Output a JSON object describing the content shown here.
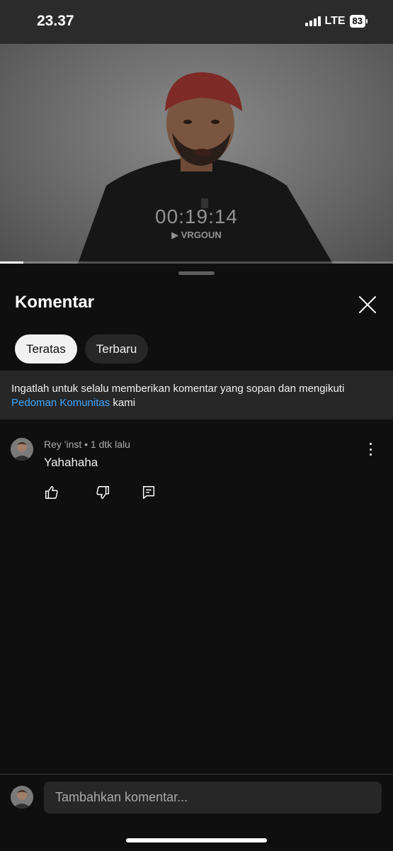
{
  "status_bar": {
    "time": "23.37",
    "network": "LTE",
    "battery": "83"
  },
  "video": {
    "timestamp": "00:19:14",
    "watermark": "VRGOUN",
    "progress": 0.06
  },
  "sheet": {
    "title": "Komentar",
    "filters": [
      {
        "label": "Teratas",
        "selected": true
      },
      {
        "label": "Terbaru",
        "selected": false
      }
    ],
    "notice": {
      "text_before": "Ingatlah untuk selalu memberikan komentar yang sopan dan mengikuti ",
      "link": "Pedoman Komunitas",
      "text_after": " kami"
    },
    "comments": [
      {
        "author": "Rey 'inst",
        "time": "1 dtk lalu",
        "meta": "Rey 'inst • 1 dtk lalu",
        "text": "Yahahaha"
      }
    ],
    "add_comment_placeholder": "Tambahkan komentar..."
  },
  "icons": {
    "close": "close-icon",
    "like": "thumb-up-icon",
    "dislike": "thumb-down-icon",
    "reply": "reply-icon",
    "more": "more-vert-icon",
    "signal": "signal-icon",
    "battery": "battery-icon"
  },
  "colors": {
    "background": "#0f0f0f",
    "surface": "#272727",
    "link": "#3ea6ff",
    "chip_active": "#f1f1f1"
  }
}
